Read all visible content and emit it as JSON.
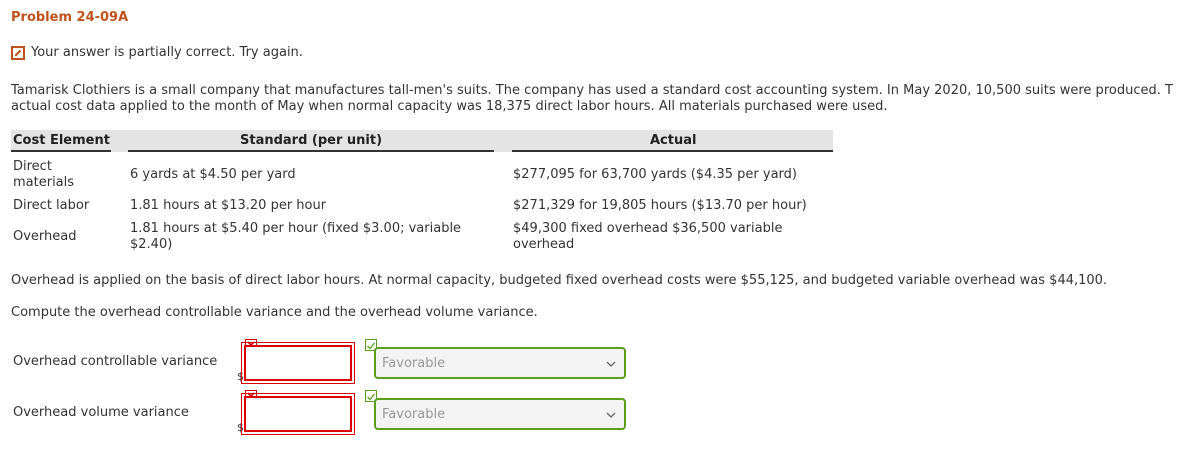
{
  "problem_title": "Problem 24-09A",
  "status_message": "Your answer is partially correct.  Try again.",
  "intro": {
    "line1": "Tamarisk Clothiers is a small company that manufactures tall-men's suits. The company has used a standard cost accounting system. In May 2020, 10,500 suits were produced. T",
    "line2": "actual cost data applied to the month of May when normal capacity was 18,375 direct labor hours. All materials purchased were used."
  },
  "table": {
    "headers": {
      "cost_element": "Cost Element",
      "standard": "Standard (per unit)",
      "actual": "Actual"
    },
    "rows": [
      {
        "element": [
          "Direct",
          "materials"
        ],
        "standard": [
          "6 yards at $4.50 per yard"
        ],
        "actual": [
          "$277,095 for 63,700 yards ($4.35 per yard)"
        ]
      },
      {
        "element": [
          "Direct labor"
        ],
        "standard": [
          "1.81 hours at $13.20 per hour"
        ],
        "actual": [
          "$271,329 for 19,805 hours ($13.70 per hour)"
        ]
      },
      {
        "element": [
          "Overhead"
        ],
        "standard": [
          "1.81 hours at $5.40 per hour (fixed $3.00; variable",
          "$2.40)"
        ],
        "actual": [
          "$49,300 fixed overhead $36,500 variable",
          "overhead"
        ]
      }
    ]
  },
  "note": "Overhead is applied on the basis of direct labor hours. At normal capacity, budgeted fixed overhead costs were $55,125, and budgeted variable overhead was $44,100.",
  "instruction": "Compute the overhead controllable variance and the overhead volume variance.",
  "answers": [
    {
      "label": "Overhead controllable variance",
      "currency": "$",
      "amount": "",
      "select_value": "Favorable",
      "amount_correct": false,
      "select_correct": true
    },
    {
      "label": "Overhead volume variance",
      "currency": "$",
      "amount": "",
      "select_value": "Favorable",
      "amount_correct": false,
      "select_correct": true
    }
  ],
  "icons": {
    "status": "pencil-icon",
    "wrong": "x-mark-icon",
    "right": "check-mark-icon",
    "dropdown": "chevron-down-icon"
  },
  "colors": {
    "title": "#c0531b",
    "wrong": "#dd0000",
    "right": "#5a9e1a",
    "header_bg": "#e4e4e4"
  }
}
